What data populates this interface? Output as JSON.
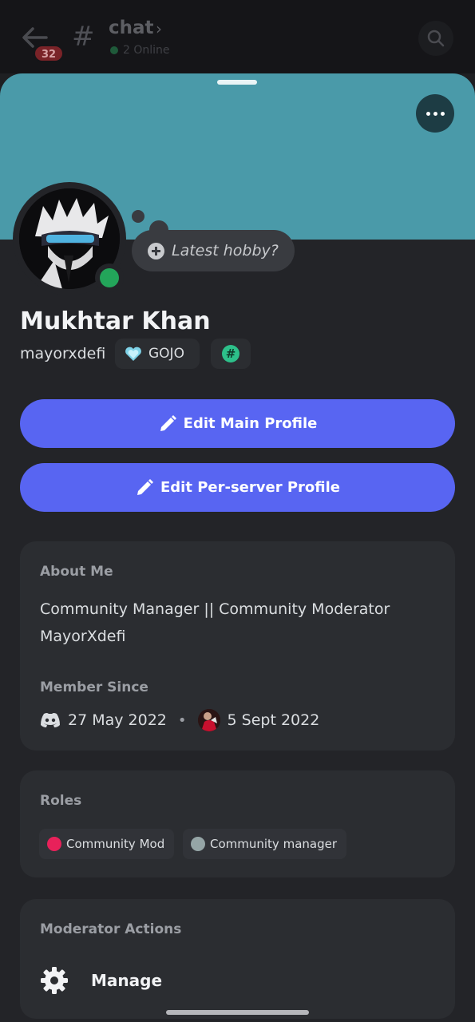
{
  "topbar": {
    "unread_badge": "32",
    "channel_name": "chat",
    "online_text": "2 Online"
  },
  "profile": {
    "hobby_prompt": "Latest hobby?",
    "display_name": "Mukhtar Khan",
    "username": "mayorxdefi",
    "clan_tag": "GOJO",
    "hash_badge": "#"
  },
  "buttons": {
    "edit_main": "Edit Main Profile",
    "edit_server": "Edit Per-server Profile"
  },
  "about": {
    "title": "About Me",
    "line1": "Community Manager || Community Moderator",
    "line2": "MayorXdefi"
  },
  "member_since": {
    "title": "Member Since",
    "discord_date": "27 May 2022",
    "separator": "•",
    "server_date": "5 Sept 2022"
  },
  "roles": {
    "title": "Roles",
    "items": [
      {
        "label": "Community Mod",
        "color": "#e8215a"
      },
      {
        "label": "Community manager",
        "color": "#95a5a6"
      }
    ]
  },
  "moderator": {
    "title": "Moderator Actions",
    "manage_label": "Manage"
  },
  "colors": {
    "banner": "#4a9aa9",
    "blurple": "#5865f2",
    "online": "#23a55a"
  },
  "icons": [
    "back-arrow-icon",
    "hashtag-icon",
    "search-icon",
    "more-icon",
    "plus-icon",
    "pencil-icon",
    "discord-icon",
    "heart-icon",
    "gear-icon"
  ]
}
